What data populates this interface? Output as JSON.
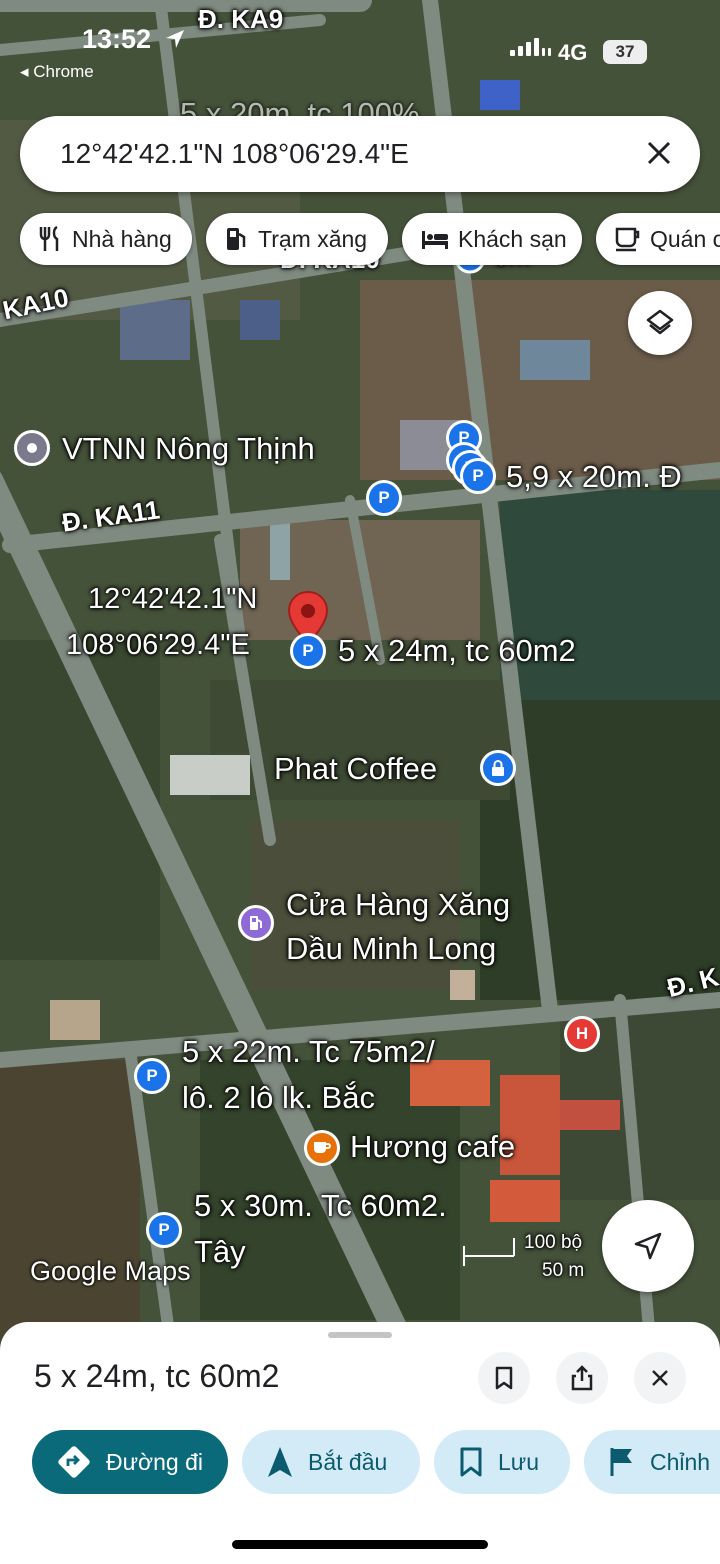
{
  "status_bar": {
    "time": "13:52",
    "back_app": "◂ Chrome",
    "network": "4G",
    "battery": "37"
  },
  "search": {
    "query": "12°42'42.1\"N 108°06'29.4\"E"
  },
  "chips": [
    {
      "label": "Nhà hàng",
      "icon": "restaurant-icon"
    },
    {
      "label": "Trạm xăng",
      "icon": "gas-station-icon"
    },
    {
      "label": "Khách sạn",
      "icon": "hotel-icon"
    },
    {
      "label": "Quán c",
      "icon": "cafe-icon"
    }
  ],
  "map": {
    "roads": {
      "ka9": "Đ. KA9",
      "ka10": "KA10",
      "ka10_partial": "Đ. KA10",
      "ka11": "Đ. KA11",
      "right_partial": "Đ. K"
    },
    "overlay_top": "5 x 20m, tc 100%",
    "places": {
      "vtnn": "VTNN Nông Thịnh",
      "lot_59": "5,9 x 20m. Đ",
      "selected_coord_line1": "12°42'42.1\"N",
      "selected_coord_line2": "108°06'29.4\"E",
      "selected_lot": "5 x 24m, tc 60m2",
      "phat_coffee": "Phat Coffee",
      "gas_line1": "Cửa Hàng Xăng",
      "gas_line2": "Dầu Minh Long",
      "lot22_line1": "5 x 22m. Tc 75m2/",
      "lot22_line2": "lô. 2 lô lk. Bắc",
      "huong_cafe": "Hương cafe",
      "lot30_line1": "5 x 30m. Tc 60m2.",
      "lot30_line2": "Tây",
      "partial_label": "5m"
    },
    "attribution": "Google Maps",
    "scale": {
      "imperial": "100 bộ",
      "metric": "50 m"
    }
  },
  "sheet": {
    "title": "5 x 24m, tc 60m2",
    "actions": [
      {
        "label": "Đường đi",
        "icon": "directions-icon"
      },
      {
        "label": "Bắt đầu",
        "icon": "navigation-arrow-icon"
      },
      {
        "label": "Lưu",
        "icon": "bookmark-icon"
      },
      {
        "label": "Chỉnh",
        "icon": "flag-icon"
      }
    ]
  },
  "colors": {
    "primary_action": "#0b6a7a",
    "action_chip": "#d3eaf7",
    "pin_parking": "#1a73e8",
    "pin_selected": "#e53935"
  }
}
